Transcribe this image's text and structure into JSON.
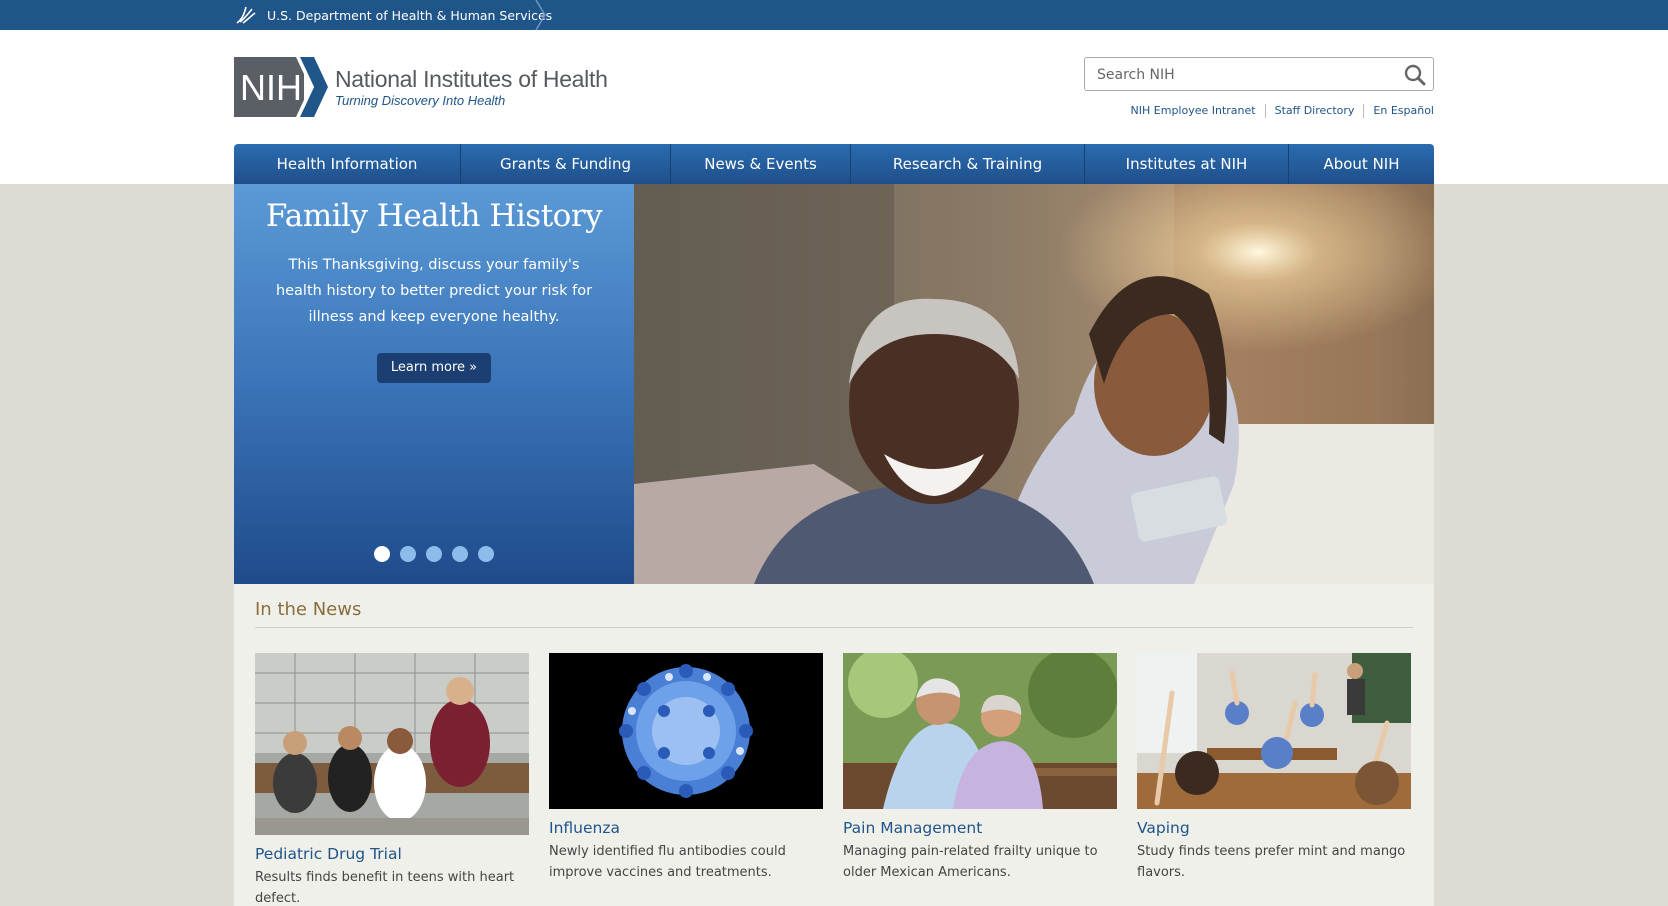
{
  "hhs": {
    "label": "U.S. Department of Health & Human Services"
  },
  "logo": {
    "mark": "NIH",
    "title": "National Institutes of Health",
    "tagline": "Turning Discovery Into Health"
  },
  "search": {
    "placeholder": "Search NIH"
  },
  "util_links": [
    "NIH Employee Intranet",
    "Staff Directory",
    "En Español"
  ],
  "nav": [
    "Health Information",
    "Grants & Funding",
    "News & Events",
    "Research & Training",
    "Institutes at NIH",
    "About NIH"
  ],
  "hero": {
    "title": "Family Health History",
    "text": "This Thanksgiving, discuss your family's health history to better predict your risk for illness and keep everyone healthy.",
    "button": "Learn more »",
    "slide_count": 5,
    "active_slide": 1
  },
  "news": {
    "heading": "In the News",
    "items": [
      {
        "title": "Pediatric Drug Trial",
        "desc": "Results finds benefit in teens with heart defect."
      },
      {
        "title": "Influenza",
        "desc": "Newly identified flu antibodies could improve vaccines and treatments."
      },
      {
        "title": "Pain Management",
        "desc": "Managing pain-related frailty unique to older Mexican Americans."
      },
      {
        "title": "Vaping",
        "desc": "Study finds teens prefer mint and mango flavors."
      }
    ]
  },
  "colors": {
    "brand_blue": "#20558a",
    "news_heading": "#8a6d3b",
    "logo_gray": "#555a60"
  }
}
